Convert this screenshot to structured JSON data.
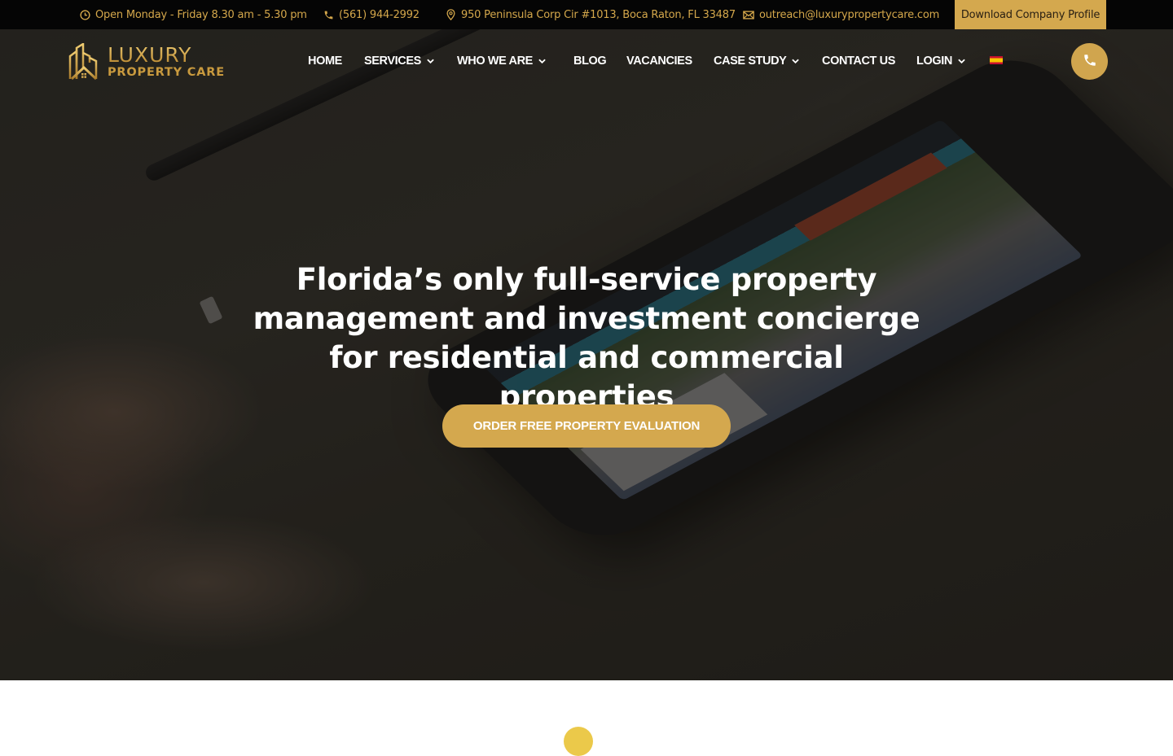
{
  "topbar": {
    "hours": {
      "icon": "clock-icon",
      "text": "Open Monday - Friday 8.30 am - 5.30 pm"
    },
    "phone": {
      "icon": "phone-icon",
      "text": "(561) 944-2992"
    },
    "address": {
      "icon": "map-pin-icon",
      "text": "950 Peninsula Corp Cir #1013, Boca Raton, FL 33487"
    },
    "email": {
      "icon": "envelope-icon",
      "text": "outreach@luxurypropertycare.com"
    },
    "download_label": "Download Company Profile"
  },
  "logo": {
    "line1": "LUXURY",
    "line2": "PROPERTY CARE"
  },
  "nav": {
    "items": [
      {
        "label": "HOME",
        "dropdown": false
      },
      {
        "label": "SERVICES",
        "dropdown": true
      },
      {
        "label": "WHO WE ARE",
        "dropdown": true
      },
      {
        "label": "BLOG",
        "dropdown": false
      },
      {
        "label": "VACANCIES",
        "dropdown": false
      },
      {
        "label": "CASE STUDY",
        "dropdown": true
      },
      {
        "label": "CONTACT US",
        "dropdown": false
      },
      {
        "label": "LOGIN",
        "dropdown": true
      }
    ],
    "language_flag": "spain-flag-icon",
    "call_button_icon": "phone-icon"
  },
  "hero": {
    "headline": "Florida’s only full-service property management and investment concierge for residential and commercial properties",
    "cta_label": "ORDER FREE PROPERTY EVALUATION"
  },
  "colors": {
    "gold": "#d4a84e",
    "topbar_bg": "#050505",
    "topbar_text": "#d4a74b",
    "white": "#ffffff"
  }
}
